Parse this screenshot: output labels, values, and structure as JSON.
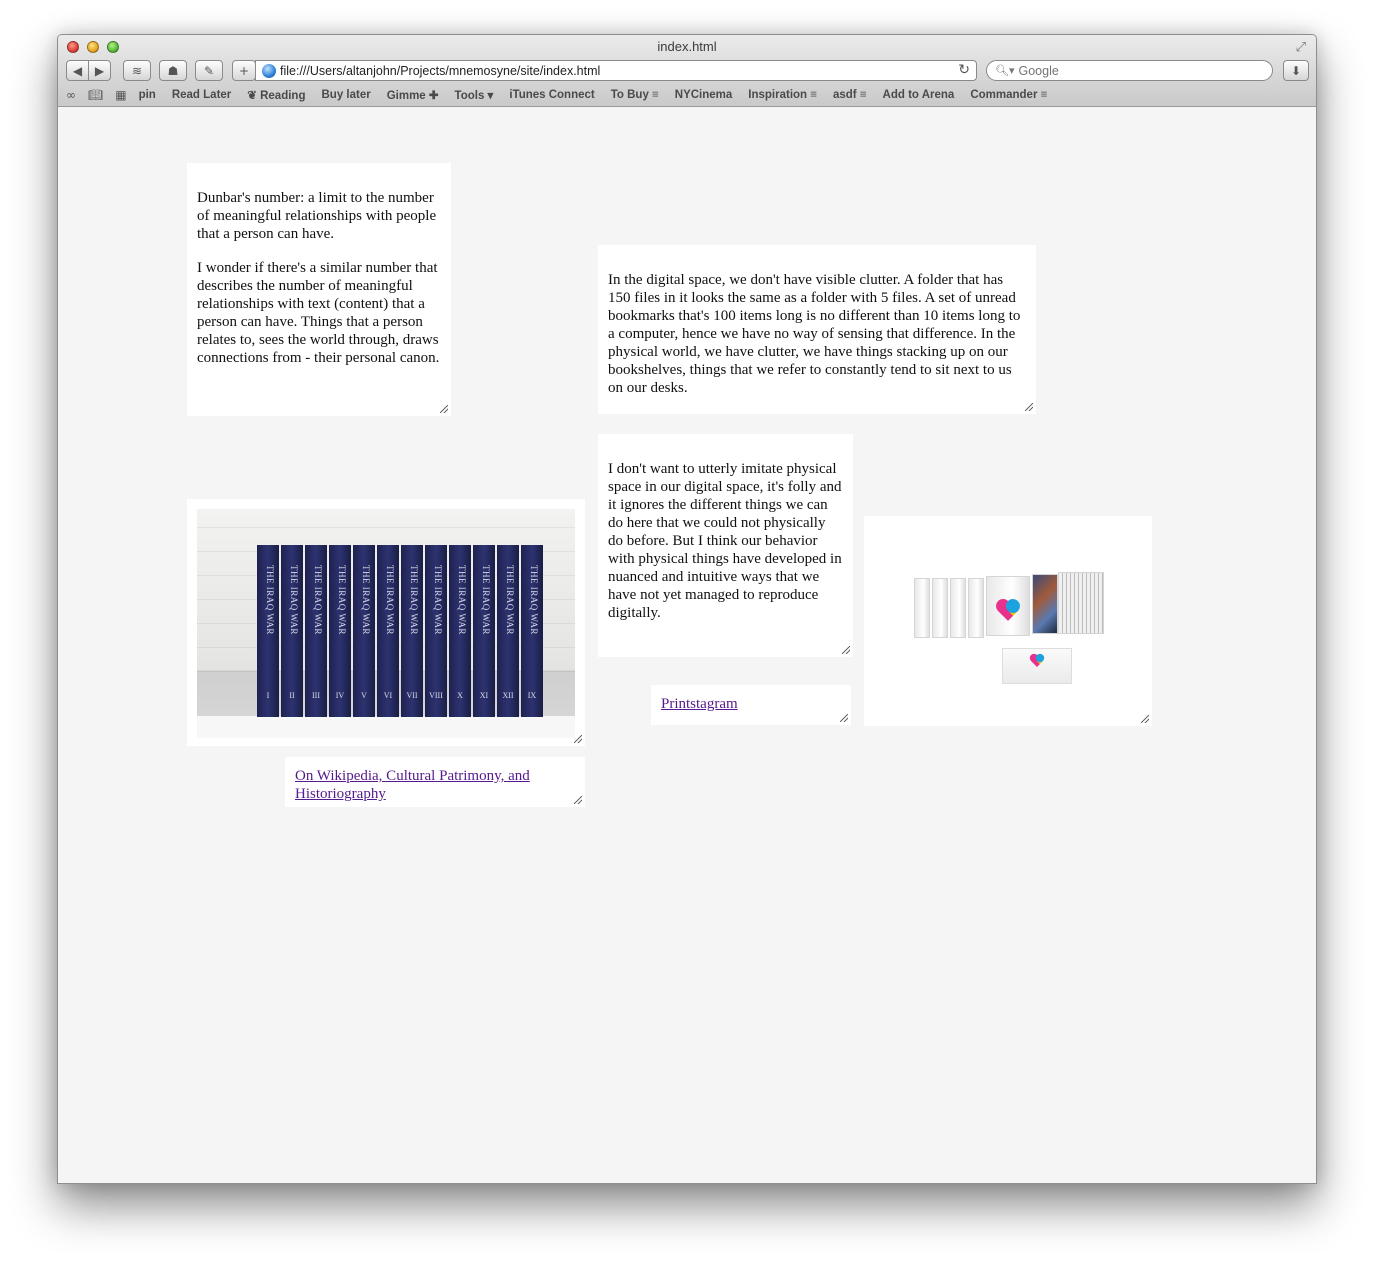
{
  "window": {
    "title": "index.html"
  },
  "toolbar": {
    "back_icon": "◀",
    "forward_icon": "▶",
    "add_icon": "+",
    "url": "file:///Users/altanjohn/Projects/mnemosyne/site/index.html",
    "search_placeholder": "Google"
  },
  "bookmarks": [
    "pin",
    "Read Later",
    "Reading",
    "Buy later",
    "Gimme",
    "Tools",
    "iTunes Connect",
    "To Buy",
    "NYCinema",
    "Inspiration",
    "asdf",
    "Add to Arena",
    "Commander"
  ],
  "cards": {
    "dunbar": {
      "p1": "Dunbar's number: a limit to the number of meaningful relationships with people that a person can have.",
      "p2": "I wonder if there's a similar number that describes the number of meaningful relationships with text (content) that a person can have. Things that a person relates to, sees the world through, draws connections from - their personal canon."
    },
    "digital_space": "In the digital space, we don't have visible clutter. A folder that has 150 files in it looks the same as a folder with 5 files. A set of unread bookmarks that's 100 items long is no different than 10 items long to a computer, hence we have no way of sensing that difference. In the physical world, we have clutter, we have things stacking up on our bookshelves, things that we refer to constantly tend to sit next to us on our desks.",
    "imitate": "I don't want to utterly imitate physical space in our digital space, it's folly and it ignores the different things we can do here that we could not physically do before. But I think our behavior with physical things have developed in nuanced and intuitive ways that we have not yet managed to reproduce digitally.",
    "link_wikipedia": "On Wikipedia, Cultural Patrimony, and Historiography",
    "link_printstagram": "Printstagram"
  },
  "books": {
    "spine_title": "THE IRAQ WAR",
    "volumes": [
      "I",
      "II",
      "III",
      "IV",
      "V",
      "VI",
      "VII",
      "VIII",
      "X",
      "XI",
      "XII",
      "IX"
    ]
  }
}
